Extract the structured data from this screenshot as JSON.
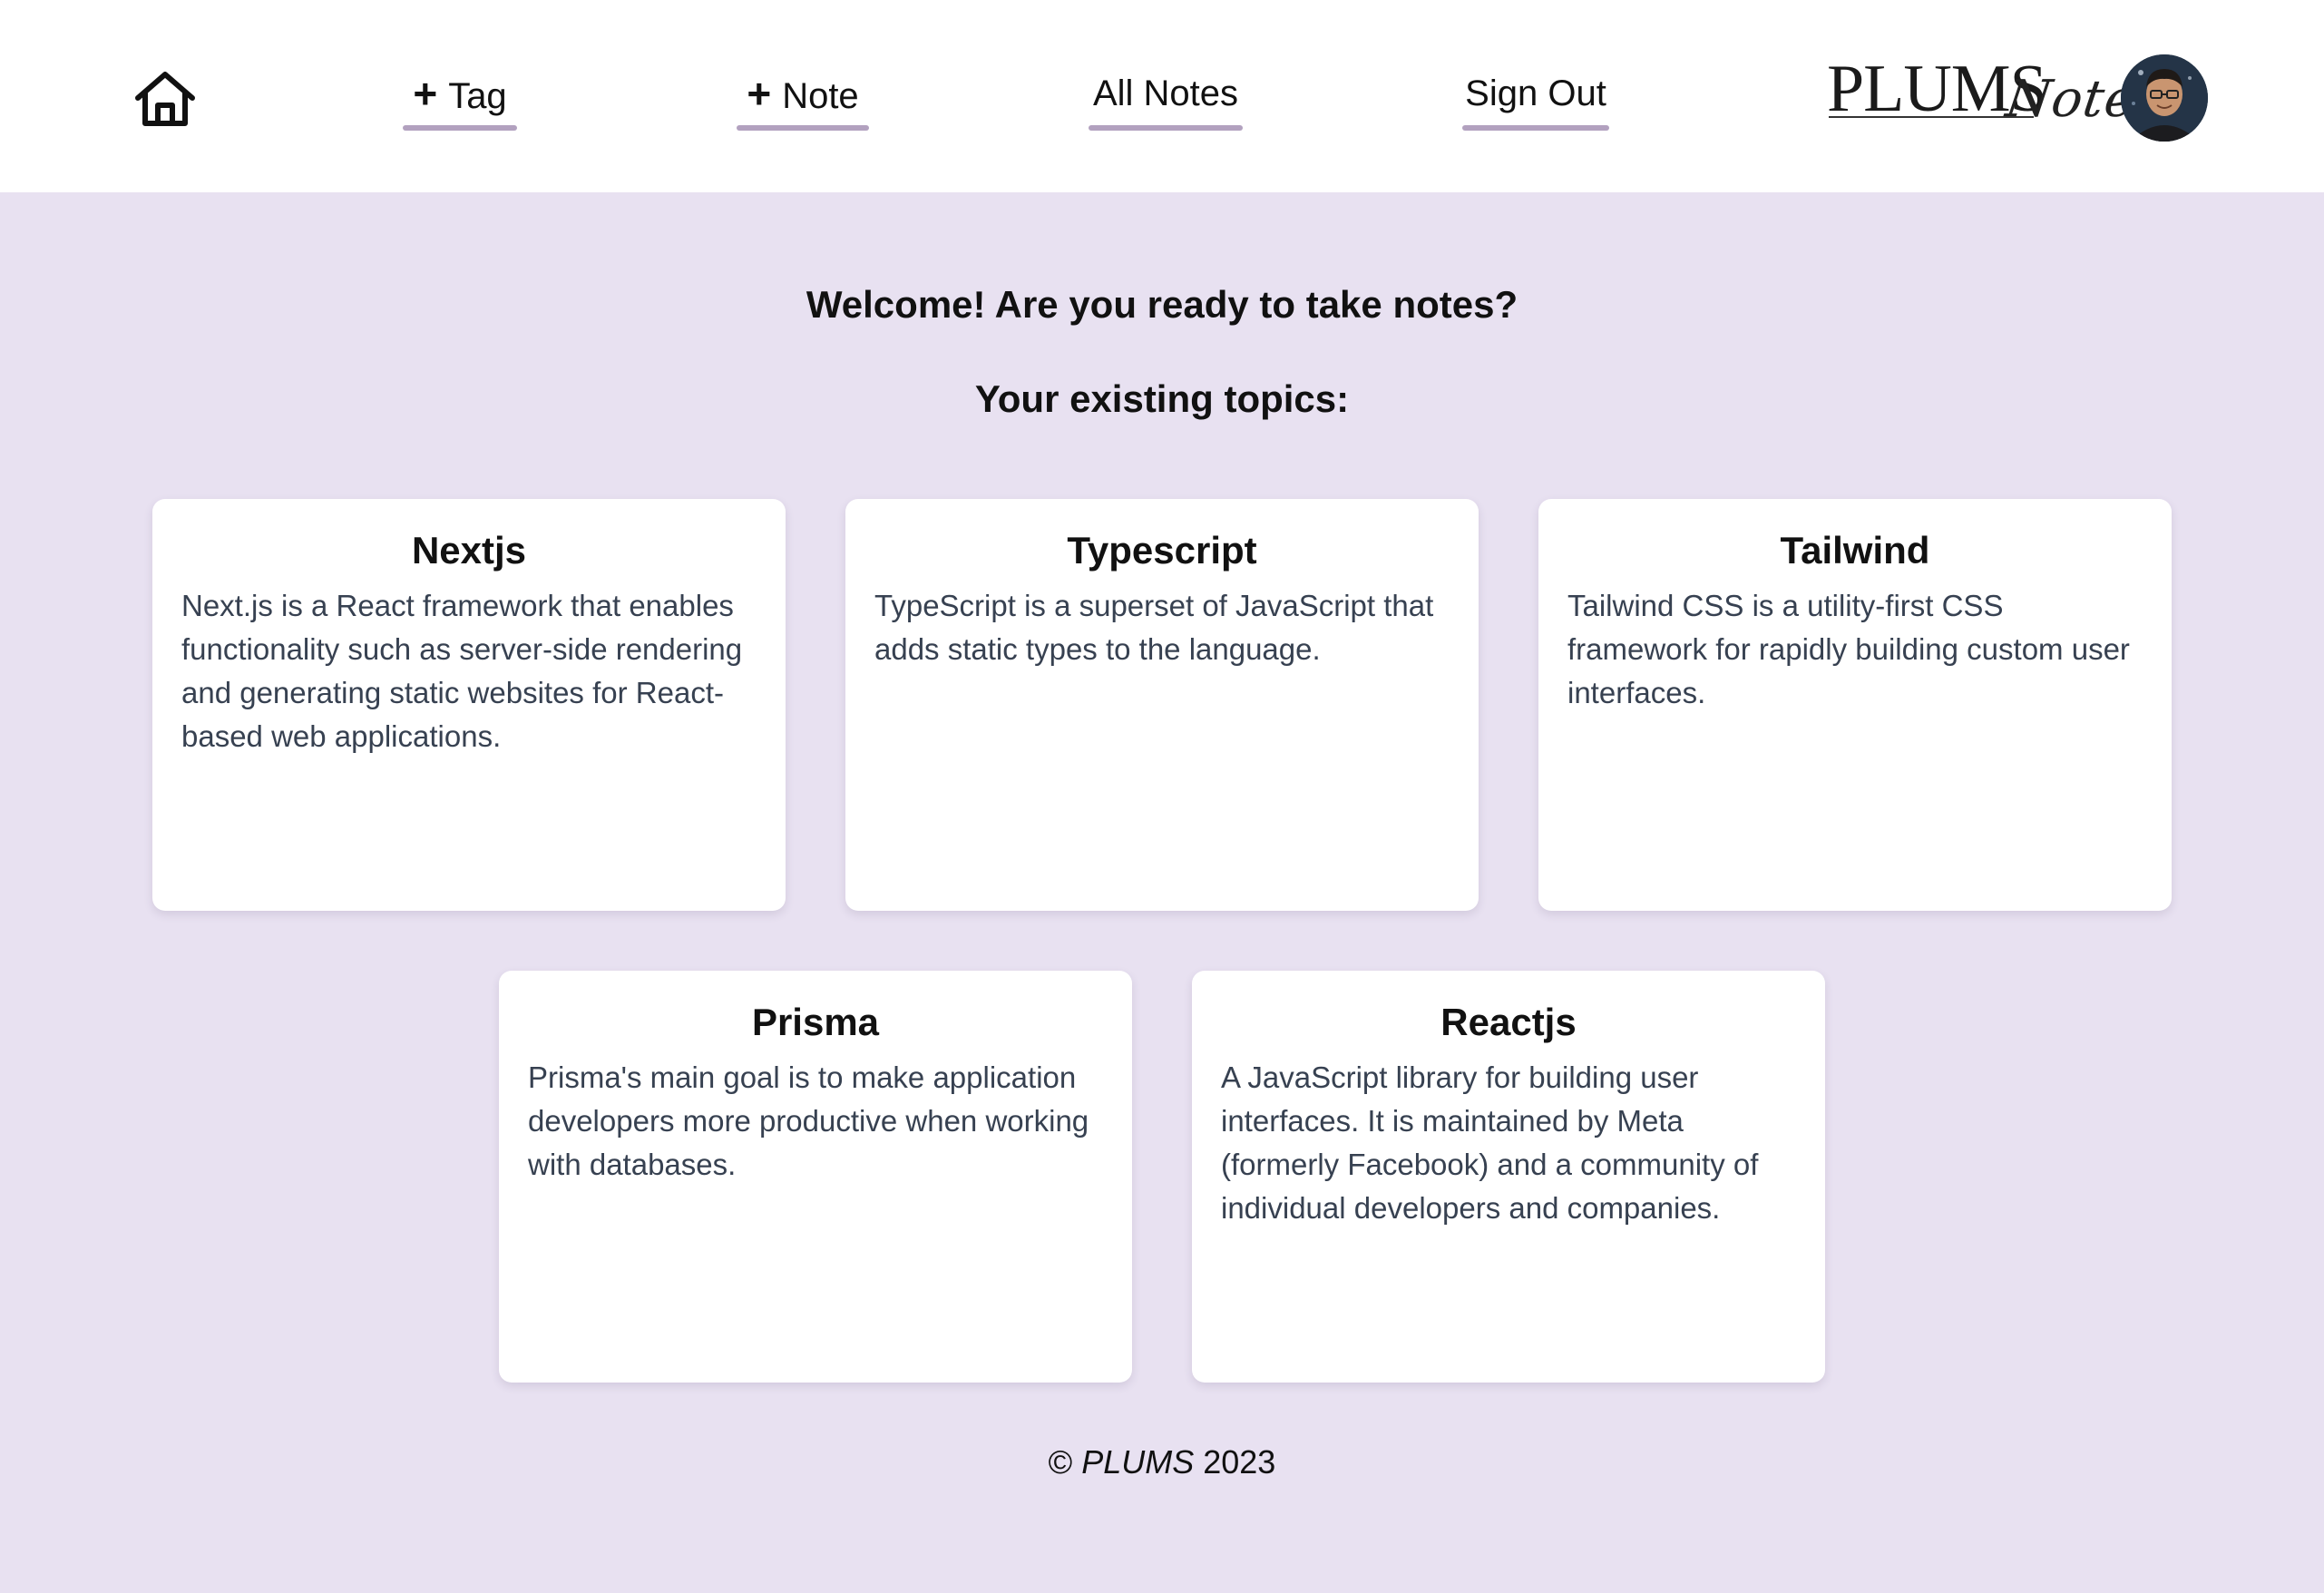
{
  "nav": {
    "home_icon": "home-icon",
    "tag_plus": "+",
    "tag_label": "Tag",
    "note_plus": "+",
    "note_label": "Note",
    "all_notes_label": "All Notes",
    "sign_out_label": "Sign Out",
    "logo_primary": "PLUMS",
    "logo_script": "Notes",
    "avatar_icon": "user-avatar",
    "underline_color": "#b2a1bf"
  },
  "main": {
    "welcome": "Welcome! Are you ready to take notes?",
    "topics_heading": "Your existing topics:",
    "background_color": "#e8e1f1",
    "topics": [
      {
        "title": "Nextjs",
        "description": "Next.js is a React framework that enables functionality such as server-side rendering and generating static websites for React-based web applications."
      },
      {
        "title": "Typescript",
        "description": "TypeScript is a superset of JavaScript that adds static types to the language."
      },
      {
        "title": "Tailwind",
        "description": "Tailwind CSS is a utility-first CSS framework for rapidly building custom user interfaces."
      },
      {
        "title": "Prisma",
        "description": "Prisma's main goal is to make application developers more productive when working with databases."
      },
      {
        "title": "Reactjs",
        "description": "A JavaScript library for building user interfaces. It is maintained by Meta (formerly Facebook) and a community of individual developers and companies."
      }
    ]
  },
  "footer": {
    "copyright_symbol": "©",
    "brand": "PLUMS",
    "year": "2023"
  }
}
